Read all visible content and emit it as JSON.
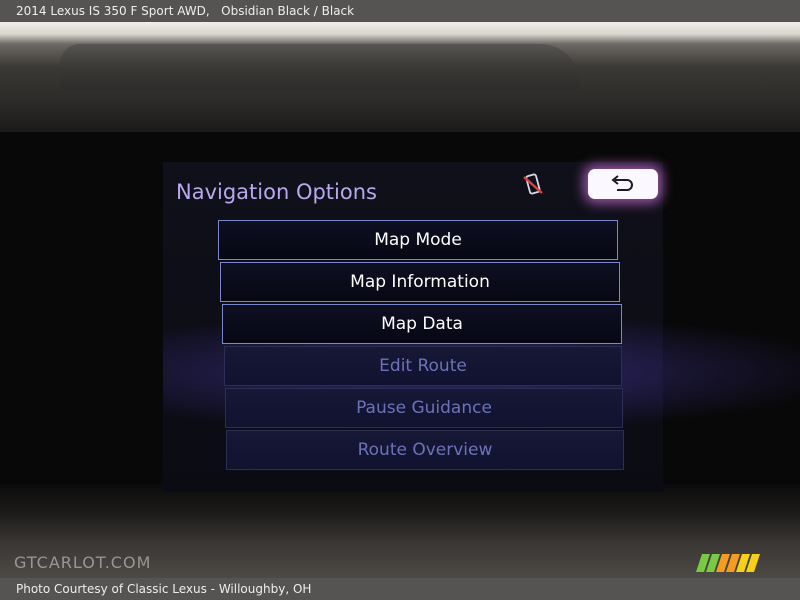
{
  "header": {
    "caption": "2014 Lexus IS 350 F Sport AWD,   Obsidian Black / Black"
  },
  "screen": {
    "title": "Navigation Options",
    "status_icon": "phone-disconnected-icon",
    "back_icon": "back-arrow-icon",
    "menu": [
      {
        "label": "Map Mode",
        "enabled": true
      },
      {
        "label": "Map Information",
        "enabled": true
      },
      {
        "label": "Map Data",
        "enabled": true
      },
      {
        "label": "Edit Route",
        "enabled": false
      },
      {
        "label": "Pause Guidance",
        "enabled": false
      },
      {
        "label": "Route Overview",
        "enabled": false
      }
    ]
  },
  "watermark": {
    "text": "GTCARLOT.COM"
  },
  "footer": {
    "caption": "Photo Courtesy of Classic Lexus - Willoughby, OH"
  },
  "colors": {
    "accent_title": "#b8a8f0",
    "button_border": "#7d86c8",
    "disabled_text": "#6c72b8",
    "back_glow": "#dc78e6",
    "logo_green": "#7ac943",
    "logo_yellow": "#f7d117",
    "logo_orange": "#f39c1f"
  }
}
